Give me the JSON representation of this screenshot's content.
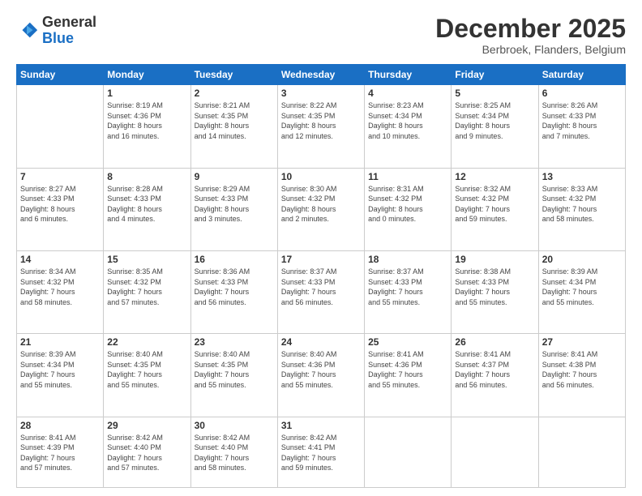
{
  "logo": {
    "general": "General",
    "blue": "Blue"
  },
  "header": {
    "month": "December 2025",
    "location": "Berbroek, Flanders, Belgium"
  },
  "weekdays": [
    "Sunday",
    "Monday",
    "Tuesday",
    "Wednesday",
    "Thursday",
    "Friday",
    "Saturday"
  ],
  "weeks": [
    [
      {
        "day": "",
        "info": ""
      },
      {
        "day": "1",
        "info": "Sunrise: 8:19 AM\nSunset: 4:36 PM\nDaylight: 8 hours\nand 16 minutes."
      },
      {
        "day": "2",
        "info": "Sunrise: 8:21 AM\nSunset: 4:35 PM\nDaylight: 8 hours\nand 14 minutes."
      },
      {
        "day": "3",
        "info": "Sunrise: 8:22 AM\nSunset: 4:35 PM\nDaylight: 8 hours\nand 12 minutes."
      },
      {
        "day": "4",
        "info": "Sunrise: 8:23 AM\nSunset: 4:34 PM\nDaylight: 8 hours\nand 10 minutes."
      },
      {
        "day": "5",
        "info": "Sunrise: 8:25 AM\nSunset: 4:34 PM\nDaylight: 8 hours\nand 9 minutes."
      },
      {
        "day": "6",
        "info": "Sunrise: 8:26 AM\nSunset: 4:33 PM\nDaylight: 8 hours\nand 7 minutes."
      }
    ],
    [
      {
        "day": "7",
        "info": "Sunrise: 8:27 AM\nSunset: 4:33 PM\nDaylight: 8 hours\nand 6 minutes."
      },
      {
        "day": "8",
        "info": "Sunrise: 8:28 AM\nSunset: 4:33 PM\nDaylight: 8 hours\nand 4 minutes."
      },
      {
        "day": "9",
        "info": "Sunrise: 8:29 AM\nSunset: 4:33 PM\nDaylight: 8 hours\nand 3 minutes."
      },
      {
        "day": "10",
        "info": "Sunrise: 8:30 AM\nSunset: 4:32 PM\nDaylight: 8 hours\nand 2 minutes."
      },
      {
        "day": "11",
        "info": "Sunrise: 8:31 AM\nSunset: 4:32 PM\nDaylight: 8 hours\nand 0 minutes."
      },
      {
        "day": "12",
        "info": "Sunrise: 8:32 AM\nSunset: 4:32 PM\nDaylight: 7 hours\nand 59 minutes."
      },
      {
        "day": "13",
        "info": "Sunrise: 8:33 AM\nSunset: 4:32 PM\nDaylight: 7 hours\nand 58 minutes."
      }
    ],
    [
      {
        "day": "14",
        "info": "Sunrise: 8:34 AM\nSunset: 4:32 PM\nDaylight: 7 hours\nand 58 minutes."
      },
      {
        "day": "15",
        "info": "Sunrise: 8:35 AM\nSunset: 4:32 PM\nDaylight: 7 hours\nand 57 minutes."
      },
      {
        "day": "16",
        "info": "Sunrise: 8:36 AM\nSunset: 4:33 PM\nDaylight: 7 hours\nand 56 minutes."
      },
      {
        "day": "17",
        "info": "Sunrise: 8:37 AM\nSunset: 4:33 PM\nDaylight: 7 hours\nand 56 minutes."
      },
      {
        "day": "18",
        "info": "Sunrise: 8:37 AM\nSunset: 4:33 PM\nDaylight: 7 hours\nand 55 minutes."
      },
      {
        "day": "19",
        "info": "Sunrise: 8:38 AM\nSunset: 4:33 PM\nDaylight: 7 hours\nand 55 minutes."
      },
      {
        "day": "20",
        "info": "Sunrise: 8:39 AM\nSunset: 4:34 PM\nDaylight: 7 hours\nand 55 minutes."
      }
    ],
    [
      {
        "day": "21",
        "info": "Sunrise: 8:39 AM\nSunset: 4:34 PM\nDaylight: 7 hours\nand 55 minutes."
      },
      {
        "day": "22",
        "info": "Sunrise: 8:40 AM\nSunset: 4:35 PM\nDaylight: 7 hours\nand 55 minutes."
      },
      {
        "day": "23",
        "info": "Sunrise: 8:40 AM\nSunset: 4:35 PM\nDaylight: 7 hours\nand 55 minutes."
      },
      {
        "day": "24",
        "info": "Sunrise: 8:40 AM\nSunset: 4:36 PM\nDaylight: 7 hours\nand 55 minutes."
      },
      {
        "day": "25",
        "info": "Sunrise: 8:41 AM\nSunset: 4:36 PM\nDaylight: 7 hours\nand 55 minutes."
      },
      {
        "day": "26",
        "info": "Sunrise: 8:41 AM\nSunset: 4:37 PM\nDaylight: 7 hours\nand 56 minutes."
      },
      {
        "day": "27",
        "info": "Sunrise: 8:41 AM\nSunset: 4:38 PM\nDaylight: 7 hours\nand 56 minutes."
      }
    ],
    [
      {
        "day": "28",
        "info": "Sunrise: 8:41 AM\nSunset: 4:39 PM\nDaylight: 7 hours\nand 57 minutes."
      },
      {
        "day": "29",
        "info": "Sunrise: 8:42 AM\nSunset: 4:40 PM\nDaylight: 7 hours\nand 57 minutes."
      },
      {
        "day": "30",
        "info": "Sunrise: 8:42 AM\nSunset: 4:40 PM\nDaylight: 7 hours\nand 58 minutes."
      },
      {
        "day": "31",
        "info": "Sunrise: 8:42 AM\nSunset: 4:41 PM\nDaylight: 7 hours\nand 59 minutes."
      },
      {
        "day": "",
        "info": ""
      },
      {
        "day": "",
        "info": ""
      },
      {
        "day": "",
        "info": ""
      }
    ]
  ]
}
